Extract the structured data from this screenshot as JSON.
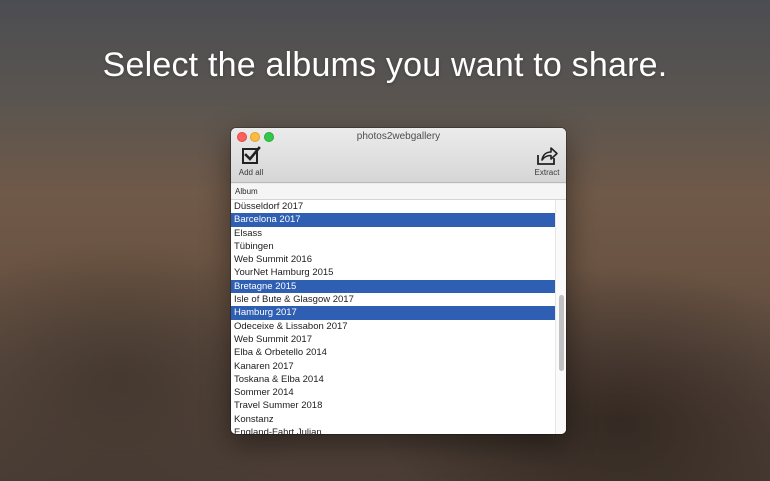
{
  "headline": "Select the albums you want to share.",
  "window": {
    "title": "photos2webgallery",
    "toolbar": {
      "add_all_label": "Add all",
      "extract_label": "Extract"
    }
  },
  "album_list": {
    "column_header": "Album",
    "rows": [
      {
        "label": "Düsseldorf 2017",
        "selected": false
      },
      {
        "label": "Barcelona 2017",
        "selected": true
      },
      {
        "label": "Elsass",
        "selected": false
      },
      {
        "label": "Tübingen",
        "selected": false
      },
      {
        "label": "Web Summit 2016",
        "selected": false
      },
      {
        "label": "YourNet Hamburg 2015",
        "selected": false
      },
      {
        "label": "Bretagne 2015",
        "selected": true
      },
      {
        "label": "Isle of Bute & Glasgow 2017",
        "selected": false
      },
      {
        "label": "Hamburg 2017",
        "selected": true
      },
      {
        "label": "Odeceixe & Lissabon 2017",
        "selected": false
      },
      {
        "label": "Web Summit 2017",
        "selected": false
      },
      {
        "label": "Elba & Orbetello 2014",
        "selected": false
      },
      {
        "label": "Kanaren 2017",
        "selected": false
      },
      {
        "label": "Toskana & Elba 2014",
        "selected": false
      },
      {
        "label": "Sommer 2014",
        "selected": false
      },
      {
        "label": "Travel Summer 2018",
        "selected": false
      },
      {
        "label": "Konstanz",
        "selected": false
      },
      {
        "label": "England-Fahrt Julian",
        "selected": false
      }
    ]
  },
  "colors": {
    "selection": "#2f5fb2",
    "close": "#fc605c",
    "minimize": "#fdbc40",
    "maximize": "#34c84a"
  },
  "icons": {
    "add_all": "checkbox-check-icon",
    "extract": "share-arrow-icon"
  }
}
